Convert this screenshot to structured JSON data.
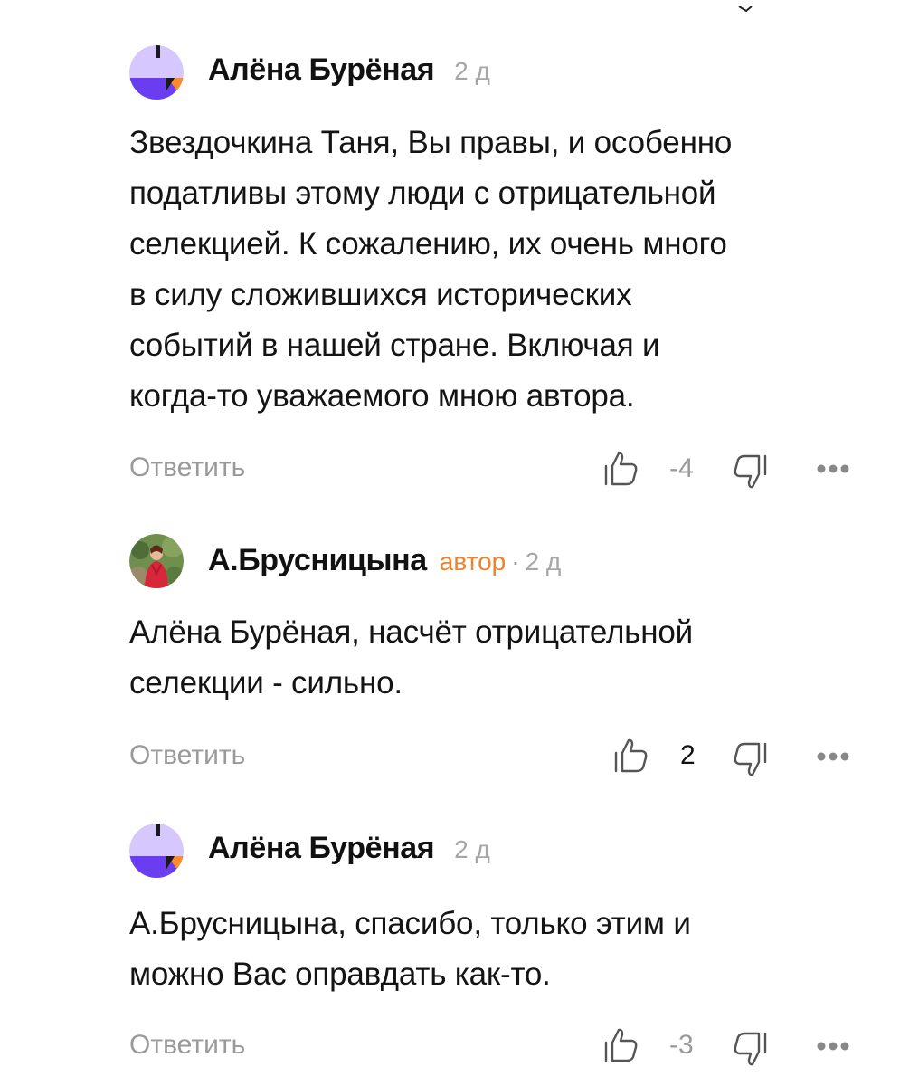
{
  "comments": [
    {
      "author": "Алёна Бурёная",
      "is_author": false,
      "time": "2 д",
      "text": "Звездочкина Таня, Вы правы, и особенно\nподатливы этому люди с отрицательной\nселекцией. К сожалению, их очень много\nв силу сложившихся исторических\nсобытий в нашей стране. Включая и\nкогда-то уважаемого мною автора.",
      "reply_label": "Ответить",
      "rating": "-4",
      "avatar_icon": "avatar-abstract-icon"
    },
    {
      "author": "А.Брусницына",
      "is_author": true,
      "author_badge": "автор",
      "separator": "·",
      "time": "2 д",
      "text": "Алёна Бурёная, насчёт отрицательной\nселекции - сильно.",
      "reply_label": "Ответить",
      "rating": "2",
      "avatar_icon": "avatar-photo-icon"
    },
    {
      "author": "Алёна Бурёная",
      "is_author": false,
      "time": "2 д",
      "text": "А.Брусницына, спасибо, только этим и\nможно Вас оправдать как-то.",
      "reply_label": "Ответить",
      "rating": "-3",
      "avatar_icon": "avatar-abstract-icon"
    }
  ],
  "colors": {
    "author_badge": "#f0822d",
    "muted_text": "#9a9a9a",
    "avatar_lavender": "#d6c8ff",
    "avatar_purple": "#6a3ef0",
    "avatar_orange": "#ff8a2a"
  },
  "icons": {
    "like": "thumbs-up-icon",
    "dislike": "thumbs-down-icon",
    "more": "more-dots-icon"
  }
}
